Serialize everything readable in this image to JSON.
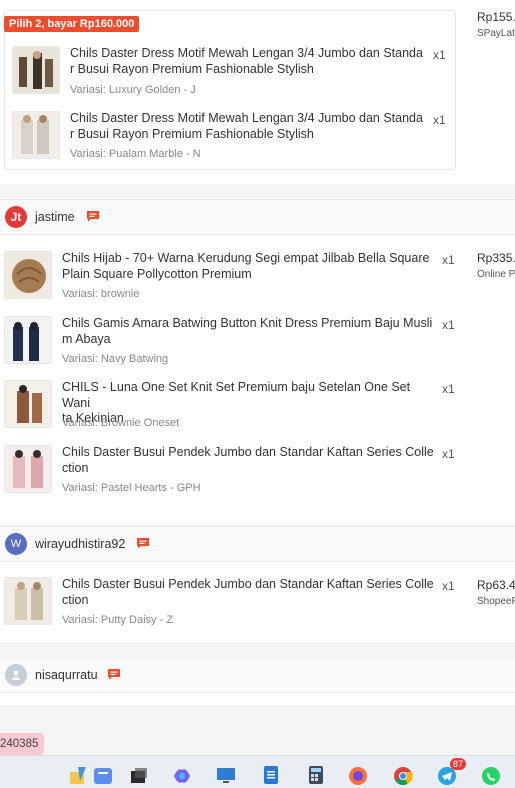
{
  "order1": {
    "promo_label": "Pilih 2, bayar Rp160.000",
    "price": "Rp155.",
    "payment": "SPayLat",
    "items": [
      {
        "title_1": "Chils Daster Dress Motif Mewah Lengan 3/4 Jumbo dan Standa",
        "title_2": "r Busui Rayon Premium Fashionable Stylish",
        "variant": "Variasi: Luxury Golden - J",
        "qty": "x1"
      },
      {
        "title_1": "Chils Daster Dress Motif Mewah Lengan 3/4 Jumbo dan Standa",
        "title_2": "r Busui Rayon Premium Fashionable Stylish",
        "variant": "Variasi: Pualam Marble - N",
        "qty": "x1"
      }
    ]
  },
  "order2": {
    "buyer": "jastime",
    "price": "Rp335.",
    "payment": "Online P",
    "items": [
      {
        "title_1": "Chils Hijab - 70+ Warna Kerudung Segi empat Jilbab Bella Square",
        "title_2": "Plain Square Pollycotton Premium",
        "variant": "Variasi: brownie",
        "qty": "x1"
      },
      {
        "title_1": "Chils Gamis Amara Batwing Button Knit Dress Premium Baju Musli",
        "title_2": "m Abaya",
        "variant": "Variasi: Navy Batwing",
        "qty": "x1"
      },
      {
        "title_1": "CHILS - Luna One Set Knit Set Premium baju Setelan One Set Wani",
        "title_2": "ta Kekinian",
        "variant": "Variasi: Brownie Oneset",
        "qty": "x1"
      },
      {
        "title_1": "Chils Daster Busui Pendek Jumbo dan Standar Kaftan Series Colle",
        "title_2": "ction",
        "variant": "Variasi: Pastel Hearts - GPH",
        "qty": "x1"
      }
    ]
  },
  "order3": {
    "buyer": "wirayudhistira92",
    "avatar_letter": "W",
    "price": "Rp63.4",
    "payment": "ShopeeP",
    "items": [
      {
        "title_1": "Chils Daster Busui Pendek Jumbo dan Standar Kaftan Series Colle",
        "title_2": "ction",
        "variant": "Variasi: Putty Daisy - Z",
        "qty": "x1"
      }
    ]
  },
  "order4": {
    "buyer": "nisaqurratu"
  },
  "order_id_fragment": "240385",
  "taskbar": {
    "telegram_badge": "87",
    "icons": [
      "notes-icon",
      "terminal-icon",
      "copilot-icon",
      "monitor-icon",
      "notepad-icon",
      "calculator-icon",
      "firefox-icon",
      "chrome-icon",
      "telegram-icon",
      "whatsapp-icon"
    ]
  },
  "colors": {
    "accent": "#ee4d2d",
    "jastime_avatar": "#e53935",
    "wira_avatar": "#5c6bc0",
    "nisa_avatar": "#c7ced8"
  }
}
